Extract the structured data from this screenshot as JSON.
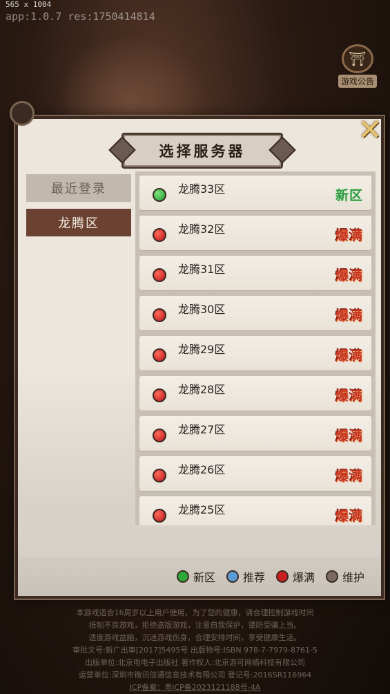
{
  "debug": {
    "dimensions": "565 x 1004",
    "version": "app:1.0.7 res:1750414814"
  },
  "notice": {
    "label": "游戏公告"
  },
  "panel": {
    "title": "选择服务器",
    "close_icon": "close-x-icon"
  },
  "sidebar": {
    "items": [
      {
        "label": "最近登录",
        "active": false
      },
      {
        "label": "龙腾区",
        "active": true
      }
    ]
  },
  "servers": [
    {
      "name": "龙腾33区",
      "status": "新区",
      "dot": "green"
    },
    {
      "name": "龙腾32区",
      "status": "爆满",
      "dot": "red"
    },
    {
      "name": "龙腾31区",
      "status": "爆满",
      "dot": "red"
    },
    {
      "name": "龙腾30区",
      "status": "爆满",
      "dot": "red"
    },
    {
      "name": "龙腾29区",
      "status": "爆满",
      "dot": "red"
    },
    {
      "name": "龙腾28区",
      "status": "爆满",
      "dot": "red"
    },
    {
      "name": "龙腾27区",
      "status": "爆满",
      "dot": "red"
    },
    {
      "name": "龙腾26区",
      "status": "爆满",
      "dot": "red"
    },
    {
      "name": "龙腾25区",
      "status": "爆满",
      "dot": "red"
    }
  ],
  "legend": [
    {
      "label": "新区",
      "color": "#2ea83a"
    },
    {
      "label": "推荐",
      "color": "#5b9bd5"
    },
    {
      "label": "爆满",
      "color": "#c8201e"
    },
    {
      "label": "维护",
      "color": "#7a6a62"
    }
  ],
  "footer": {
    "line1": "本游戏适合16周岁以上用户使用，为了您的健康，请合理控制游戏时间",
    "line2": "抵制不良游戏，拒绝盗版游戏，注意自我保护，谨防受骗上当。",
    "line3": "适度游戏益脑，沉迷游戏伤身，合理安排时间，享受健康生活。",
    "line4": "审批文号:新广出审[2017]5495号  出版物号:ISBN 978-7-7979-8761-5",
    "line5": "出版单位:北京电电子出版社  著作权人:北京游可网络科技有限公司",
    "line6": "运营单位:深圳市微讯信通信息技术有限公司  登记号:2016SR116964",
    "line7": "ICP备案：粤ICP备2023121188号-4A"
  }
}
